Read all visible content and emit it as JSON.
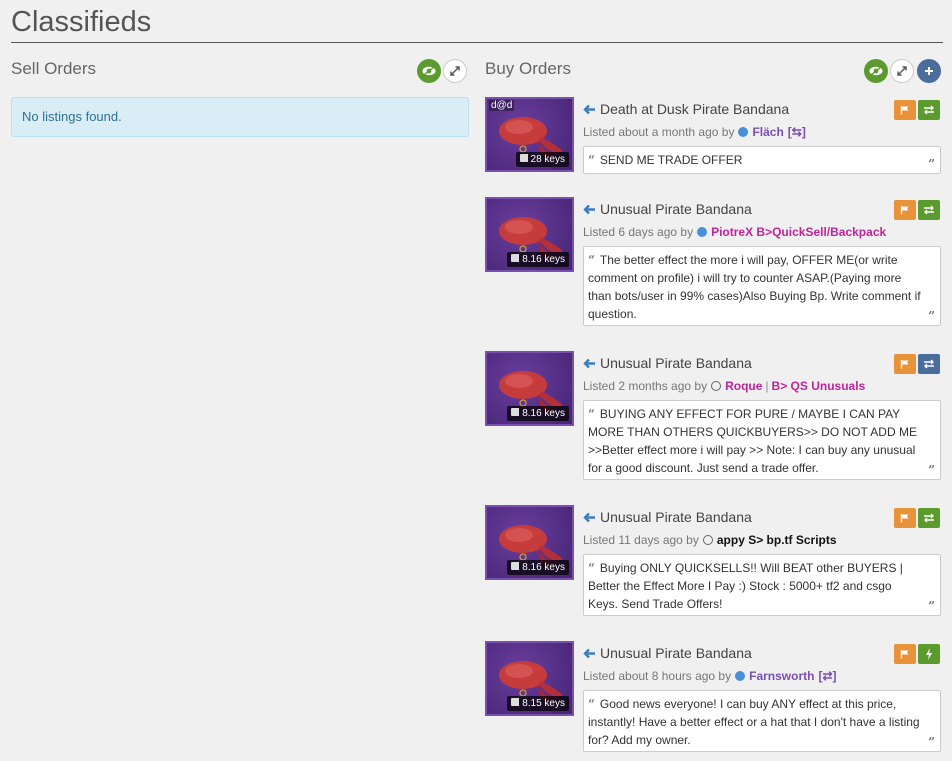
{
  "page": {
    "title": "Classifieds"
  },
  "sell": {
    "title": "Sell Orders",
    "empty_message": "No listings found."
  },
  "buy": {
    "title": "Buy Orders",
    "listings": [
      {
        "name": "Death at Dusk Pirate Bandana",
        "image_label": "d@d",
        "price": "28 keys",
        "listed": "Listed about a month ago by",
        "user": "Fläch",
        "user_suffix": "[⇆]",
        "comment": "SEND ME TRADE OFFER"
      },
      {
        "name": "Unusual Pirate Bandana",
        "price": "8.16 keys",
        "listed": "Listed 6 days ago by",
        "user": "PiotreX B>QuickSell/Backpack",
        "comment": "The better effect the more i will pay, OFFER ME(or write comment on profile) i will try to counter ASAP.(Paying more than bots/user in 99% cases)Also Buying Bp. Write comment if question."
      },
      {
        "name": "Unusual Pirate Bandana",
        "price": "8.16 keys",
        "listed": "Listed 2 months ago by",
        "user": "Roque",
        "user_sep": "|",
        "user_extra": "B> QS Unusuals",
        "comment": "BUYING ANY EFFECT FOR PURE / MAYBE I CAN PAY MORE THAN OTHERS QUICKBUYERS>> DO NOT ADD ME >>Better effect more i will pay >> Note: I can buy any unusual for a good discount. Just send a trade offer."
      },
      {
        "name": "Unusual Pirate Bandana",
        "price": "8.16 keys",
        "listed": "Listed 11 days ago by",
        "user": "appy S> bp.tf Scripts",
        "comment": "Buying ONLY QUICKSELLS!! Will BEAT other BUYERS | Better the Effect More I Pay :) Stock : 5000+ tf2 and csgo Keys. Send Trade Offers!"
      },
      {
        "name": "Unusual Pirate Bandana",
        "price": "8.15 keys",
        "listed": "Listed about 8 hours ago by",
        "user": "Farnsworth",
        "user_suffix": "[⇄]",
        "comment": "Good news everyone! I can buy ANY effect at this price, instantly! Have a better effect or a hat that I don't have a listing for? Add my owner."
      }
    ]
  },
  "icons": {
    "visibility": "eye-icon",
    "expand": "expand-icon",
    "add": "plus-icon",
    "flag": "flag-icon",
    "trade": "trade-arrows-icon",
    "instant": "lightning-icon"
  },
  "colors": {
    "accent_green": "#5b9b2e",
    "accent_orange": "#e8923a",
    "accent_navy": "#4a6d9c",
    "item_bg": "#5a3a8a",
    "user_pink": "#c0249c",
    "info_bg": "#d9edf7"
  }
}
